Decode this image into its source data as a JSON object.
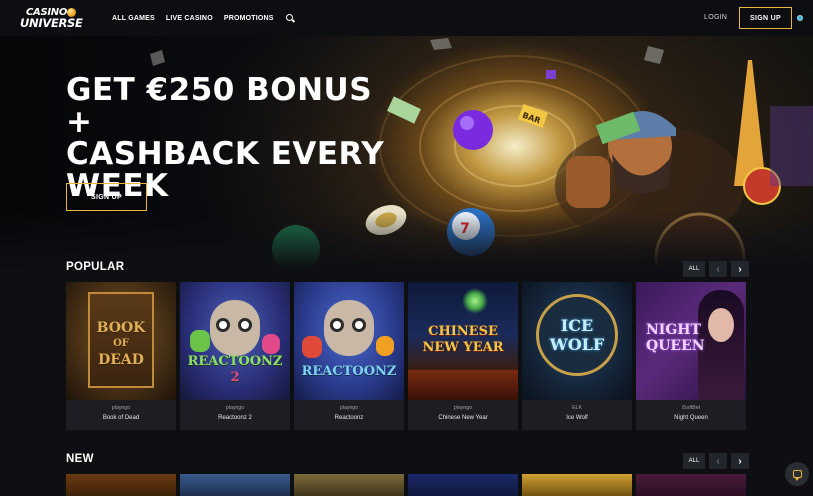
{
  "header": {
    "logo_line1": "CASINO",
    "logo_line2": "UNIVERSE",
    "nav": [
      "ALL GAMES",
      "LIVE CASINO",
      "PROMOTIONS"
    ],
    "login": "LOGIN",
    "signup": "SIGN UP"
  },
  "hero": {
    "title_lines": [
      "GET €250 BONUS +",
      "CASHBACK EVERY",
      "WEEK"
    ],
    "cta": "SIGN UP",
    "gold_badge": "BAR"
  },
  "popular": {
    "title": "POPULAR",
    "all": "ALL",
    "prev": "‹",
    "next": "›",
    "games": [
      {
        "provider": "playngo",
        "name": "Book of Dead",
        "logo": [
          "BOOK",
          "OF",
          "DEAD"
        ],
        "logo_color": "#e0b05a"
      },
      {
        "provider": "playngo",
        "name": "Reactoonz 2",
        "logo": [
          "REACTOONZ",
          "2"
        ],
        "logo_color": "#8fe066"
      },
      {
        "provider": "playngo",
        "name": "Reactoonz",
        "logo": [
          "REACTOONZ"
        ],
        "logo_color": "#7fd4f0"
      },
      {
        "provider": "playngo",
        "name": "Chinese New Year",
        "logo": [
          "CHINESE",
          "NEW YEAR"
        ],
        "logo_color": "#f4c542"
      },
      {
        "provider": "ELK",
        "name": "Ice Wolf",
        "logo": [
          "ICE",
          "WOLF"
        ],
        "logo_color": "#c9efff"
      },
      {
        "provider": "iSoftBet",
        "name": "Night Queen",
        "logo": [
          "NIGHT",
          "QUEEN"
        ],
        "logo_color": "#f2d5ff"
      }
    ]
  },
  "new": {
    "title": "NEW",
    "all": "ALL",
    "prev": "‹",
    "next": "›"
  },
  "colors": {
    "accent": "#e9b53a",
    "page_bg": "#0e0f13",
    "card_bg": "#1c1e24"
  },
  "icons": [
    "search-icon",
    "chat-icon",
    "chevron-left-icon",
    "chevron-right-icon"
  ]
}
